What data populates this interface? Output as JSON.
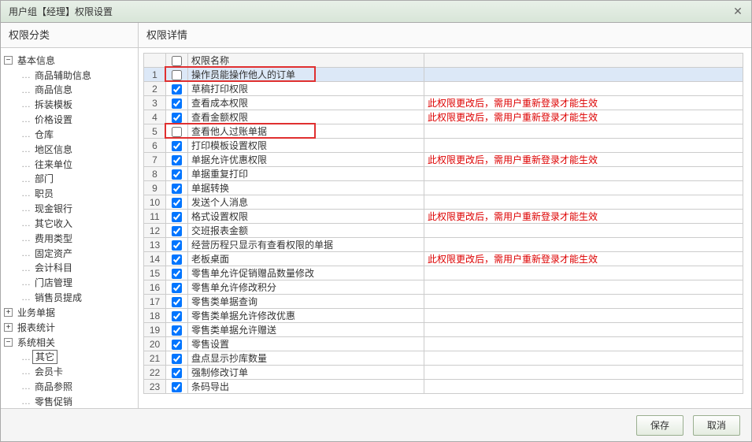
{
  "title": "用户组【经理】权限设置",
  "sidebar": {
    "header": "权限分类",
    "nodes": [
      {
        "label": "基本信息",
        "expanded": true,
        "children": [
          {
            "label": "商品辅助信息"
          },
          {
            "label": "商品信息"
          },
          {
            "label": "拆装模板"
          },
          {
            "label": "价格设置"
          },
          {
            "label": "仓库"
          },
          {
            "label": "地区信息"
          },
          {
            "label": "往来单位"
          },
          {
            "label": "部门"
          },
          {
            "label": "职员"
          },
          {
            "label": "现金银行"
          },
          {
            "label": "其它收入"
          },
          {
            "label": "费用类型"
          },
          {
            "label": "固定资产"
          },
          {
            "label": "会计科目"
          },
          {
            "label": "门店管理"
          },
          {
            "label": "销售员提成"
          }
        ]
      },
      {
        "label": "业务单据",
        "expanded": false
      },
      {
        "label": "报表统计",
        "expanded": false
      },
      {
        "label": "系统相关",
        "expanded": true,
        "children": [
          {
            "label": "其它",
            "selected": true
          },
          {
            "label": "会员卡"
          },
          {
            "label": "商品参照"
          },
          {
            "label": "零售促销"
          }
        ]
      }
    ]
  },
  "main": {
    "header": "权限详情",
    "columns": {
      "chk": "",
      "name": "权限名称",
      "note": ""
    },
    "relogin_note": "此权限更改后，需用户重新登录才能生效",
    "rows": [
      {
        "n": 1,
        "chk": false,
        "name": "操作员能操作他人的订单",
        "note": false,
        "selected": true,
        "redbox": true
      },
      {
        "n": 2,
        "chk": true,
        "name": "草稿打印权限",
        "note": false
      },
      {
        "n": 3,
        "chk": true,
        "name": "查看成本权限",
        "note": true
      },
      {
        "n": 4,
        "chk": true,
        "name": "查看金额权限",
        "note": true
      },
      {
        "n": 5,
        "chk": false,
        "name": "查看他人过账单据",
        "note": false,
        "redbox": true
      },
      {
        "n": 6,
        "chk": true,
        "name": "打印模板设置权限",
        "note": false
      },
      {
        "n": 7,
        "chk": true,
        "name": "单据允许优惠权限",
        "note": true
      },
      {
        "n": 8,
        "chk": true,
        "name": "单据重复打印",
        "note": false
      },
      {
        "n": 9,
        "chk": true,
        "name": "单据转换",
        "note": false
      },
      {
        "n": 10,
        "chk": true,
        "name": "发送个人消息",
        "note": false
      },
      {
        "n": 11,
        "chk": true,
        "name": "格式设置权限",
        "note": true
      },
      {
        "n": 12,
        "chk": true,
        "name": "交班报表金额",
        "note": false
      },
      {
        "n": 13,
        "chk": true,
        "name": "经营历程只显示有查看权限的单据",
        "note": false
      },
      {
        "n": 14,
        "chk": true,
        "name": "老板桌面",
        "note": true
      },
      {
        "n": 15,
        "chk": true,
        "name": "零售单允许促销赠品数量修改",
        "note": false
      },
      {
        "n": 16,
        "chk": true,
        "name": "零售单允许修改积分",
        "note": false
      },
      {
        "n": 17,
        "chk": true,
        "name": "零售类单据查询",
        "note": false
      },
      {
        "n": 18,
        "chk": true,
        "name": "零售类单据允许修改优惠",
        "note": false
      },
      {
        "n": 19,
        "chk": true,
        "name": "零售类单据允许赠送",
        "note": false
      },
      {
        "n": 20,
        "chk": true,
        "name": "零售设置",
        "note": false
      },
      {
        "n": 21,
        "chk": true,
        "name": "盘点显示抄库数量",
        "note": false
      },
      {
        "n": 22,
        "chk": true,
        "name": "强制修改订单",
        "note": false
      },
      {
        "n": 23,
        "chk": true,
        "name": "条码导出",
        "note": false
      }
    ]
  },
  "footer": {
    "save": "保存",
    "cancel": "取消"
  }
}
